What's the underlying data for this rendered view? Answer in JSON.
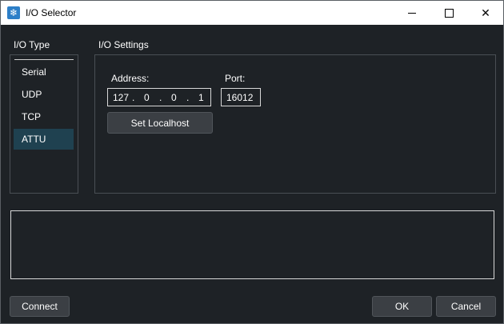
{
  "window": {
    "title": "I/O Selector",
    "icon": "snowflake-icon"
  },
  "io_type": {
    "label": "I/O Type",
    "items": [
      {
        "label": "Serial",
        "selected": false
      },
      {
        "label": "UDP",
        "selected": false
      },
      {
        "label": "TCP",
        "selected": false
      },
      {
        "label": "ATTU",
        "selected": true
      }
    ]
  },
  "settings": {
    "label": "I/O Settings",
    "address_label": "Address:",
    "address": [
      "127",
      "0",
      "0",
      "1"
    ],
    "address_separator": ".",
    "port_label": "Port:",
    "port": "16012",
    "set_localhost_label": "Set Localhost"
  },
  "log": {
    "text": ""
  },
  "footer": {
    "connect_label": "Connect",
    "ok_label": "OK",
    "cancel_label": "Cancel"
  },
  "colors": {
    "background": "#1e2226",
    "selected_item": "#1f4150",
    "button": "#3b3f44",
    "titlebar": "#ffffff"
  }
}
